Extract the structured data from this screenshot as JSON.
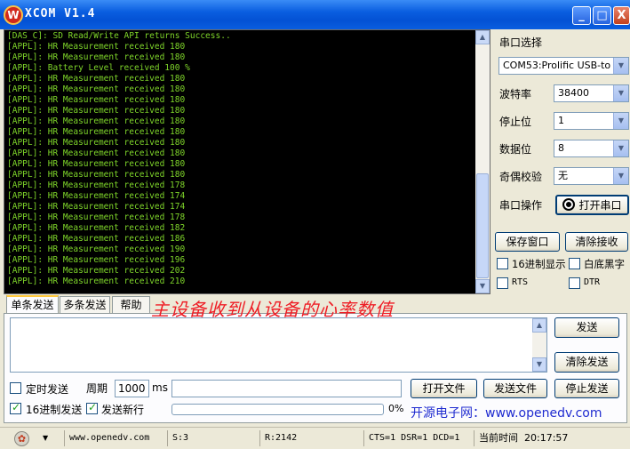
{
  "window": {
    "title": "XCOM V1.4",
    "icon_letter": "W",
    "minimize_glyph": "_",
    "maximize_glyph": "□",
    "close_glyph": "X"
  },
  "log": {
    "lines": [
      "[DAS_C]: SD Read/Write API returns Success..",
      "[APPL]: HR Measurement received 180",
      "[APPL]: HR Measurement received 180",
      "[APPL]: Battery Level received 100 %",
      "[APPL]: HR Measurement received 180",
      "[APPL]: HR Measurement received 180",
      "[APPL]: HR Measurement received 180",
      "[APPL]: HR Measurement received 180",
      "[APPL]: HR Measurement received 180",
      "[APPL]: HR Measurement received 180",
      "[APPL]: HR Measurement received 180",
      "[APPL]: HR Measurement received 180",
      "[APPL]: HR Measurement received 180",
      "[APPL]: HR Measurement received 180",
      "[APPL]: HR Measurement received 178",
      "[APPL]: HR Measurement received 174",
      "[APPL]: HR Measurement received 174",
      "[APPL]: HR Measurement received 178",
      "[APPL]: HR Measurement received 182",
      "[APPL]: HR Measurement received 186",
      "[APPL]: HR Measurement received 190",
      "[APPL]: HR Measurement received 196",
      "[APPL]: HR Measurement received 202",
      "[APPL]: HR Measurement received 210"
    ],
    "text_color": "#7fd62a",
    "background": "#000000"
  },
  "serial": {
    "port_label": "串口选择",
    "port_value": "COM53:Prolific USB-to",
    "baud_label": "波特率",
    "baud_value": "38400",
    "stopbits_label": "停止位",
    "stopbits_value": "1",
    "databits_label": "数据位",
    "databits_value": "8",
    "parity_label": "奇偶校验",
    "parity_value": "无",
    "operation_label": "串口操作",
    "open_button": "打开串口"
  },
  "receive": {
    "save_window": "保存窗口",
    "clear_receive": "清除接收",
    "hex_display": "16进制显示",
    "white_bg_black_text": "白底黑字",
    "rts": "RTS",
    "dtr": "DTR"
  },
  "tabs": [
    "单条发送",
    "多条发送",
    "帮助"
  ],
  "annotation": "主设备收到从设备的心率数值",
  "send": {
    "send_button": "发送",
    "clear_send_button": "清除发送",
    "timed_send": "定时发送",
    "period_label": "周期",
    "period_value": "1000",
    "period_unit": "ms",
    "open_file": "打开文件",
    "send_file": "发送文件",
    "stop_send": "停止发送",
    "hex_send": "16进制发送",
    "send_newline": "发送新行",
    "progress_text": "0%",
    "progress_fraction": 0,
    "promo": "开源电子网：www.openedv.com"
  },
  "statusbar": {
    "website": "www.openedv.com",
    "sent": "S:3",
    "received": "R:2142",
    "lines": "CTS=1 DSR=1 DCD=1",
    "time_label": "当前时间",
    "time_value": "20:17:57"
  },
  "icons": {
    "gear": "gear-icon",
    "chevron": "chevron-down-icon"
  }
}
